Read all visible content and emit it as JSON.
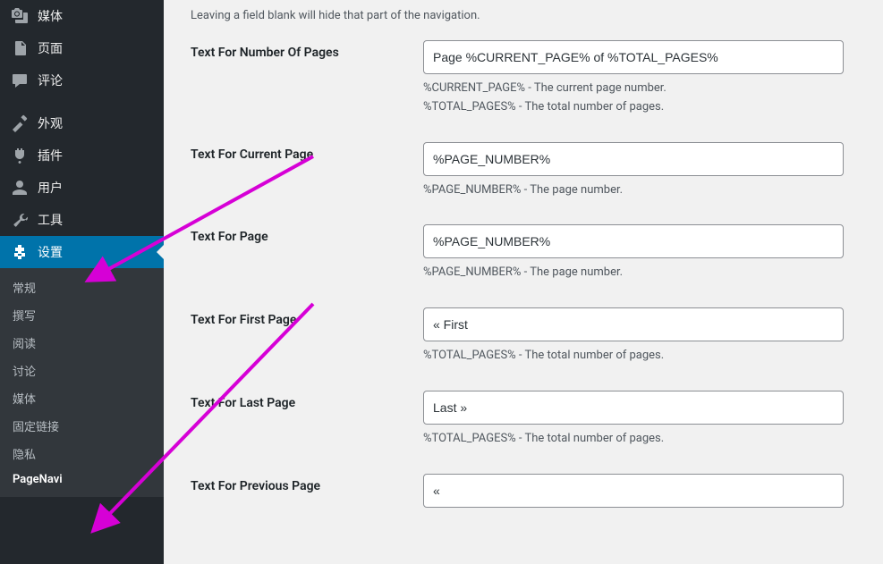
{
  "sidebar": {
    "items": [
      {
        "label": "媒体",
        "icon": "media"
      },
      {
        "label": "页面",
        "icon": "page"
      },
      {
        "label": "评论",
        "icon": "comment"
      }
    ],
    "items2": [
      {
        "label": "外观",
        "icon": "appearance"
      },
      {
        "label": "插件",
        "icon": "plugin"
      },
      {
        "label": "用户",
        "icon": "users"
      },
      {
        "label": "工具",
        "icon": "tools"
      },
      {
        "label": "设置",
        "icon": "settings",
        "active": true
      }
    ],
    "submenu": [
      "常规",
      "撰写",
      "阅读",
      "讨论",
      "媒体",
      "固定链接",
      "隐私",
      "PageNavi"
    ]
  },
  "content": {
    "intro": "Leaving a field blank will hide that part of the navigation.",
    "rows": {
      "number_of_pages": {
        "label": "Text For Number Of Pages",
        "value": "Page %CURRENT_PAGE% of %TOTAL_PAGES%",
        "desc1": "%CURRENT_PAGE% - The current page number.",
        "desc2": "%TOTAL_PAGES% - The total number of pages."
      },
      "current_page": {
        "label": "Text For Current Page",
        "value": "%PAGE_NUMBER%",
        "desc1": "%PAGE_NUMBER% - The page number."
      },
      "page": {
        "label": "Text For Page",
        "value": "%PAGE_NUMBER%",
        "desc1": "%PAGE_NUMBER% - The page number."
      },
      "first_page": {
        "label": "Text For First Page",
        "value": "« First",
        "desc1": "%TOTAL_PAGES% - The total number of pages."
      },
      "last_page": {
        "label": "Text For Last Page",
        "value": "Last »",
        "desc1": "%TOTAL_PAGES% - The total number of pages."
      },
      "previous_page": {
        "label": "Text For Previous Page",
        "value": "«"
      }
    }
  }
}
